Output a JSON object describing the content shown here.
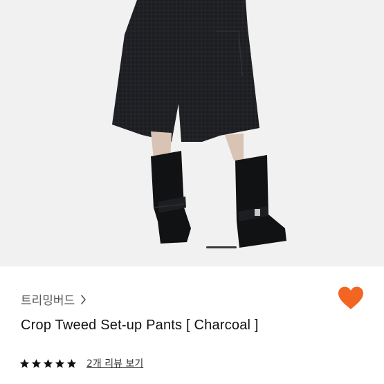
{
  "hero": {
    "carousel_position": "1"
  },
  "product": {
    "brand": "트리밍버드",
    "name": "Crop Tweed Set-up Pants [ Charcoal ]",
    "rating": 5,
    "review_link": "2개 리뷰 보기"
  },
  "colors": {
    "heart": "#f26522",
    "star": "#111111",
    "accent": "#f26522"
  },
  "icons": {
    "brand_chevron": "chevron-right-icon",
    "favorite": "heart-icon",
    "rating": "star-icon"
  }
}
